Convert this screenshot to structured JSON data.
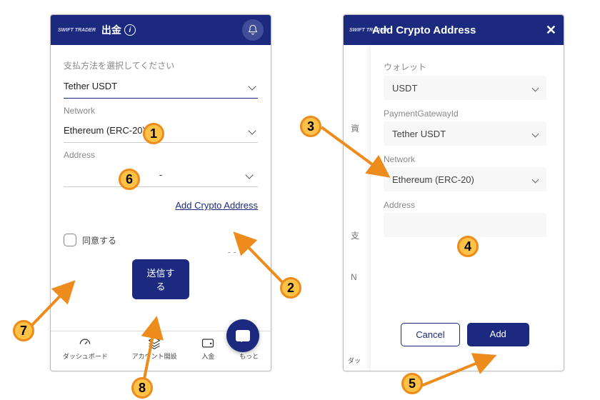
{
  "left": {
    "logo": "SWIFT TRADER",
    "title": "出金",
    "payment_label": "支払方法を選択してください",
    "payment_value": "Tether USDT",
    "network_label": "Network",
    "network_value": "Ethereum (ERC-20)",
    "address_label": "Address",
    "address_value": "-",
    "add_link": "Add Crypto Address",
    "agree": "同意する",
    "submit": "送信する",
    "dash": "- -",
    "nav": [
      {
        "label": "ダッシュボード"
      },
      {
        "label": "アカウント開設"
      },
      {
        "label": "入金"
      },
      {
        "label": "もっと"
      }
    ]
  },
  "right": {
    "logo": "SWIFT TRADER",
    "modal_title": "Add Crypto Address",
    "bg_labels": {
      "a": "資",
      "b": "支",
      "c": "N"
    },
    "bg_nav": "ダッ",
    "wallet_label": "ウォレット",
    "wallet_value": "USDT",
    "gateway_label": "PaymentGatewayId",
    "gateway_value": "Tether USDT",
    "network_label": "Network",
    "network_value": "Ethereum (ERC-20)",
    "address_label": "Address",
    "cancel": "Cancel",
    "add": "Add"
  },
  "callouts": {
    "c1": "1",
    "c2": "2",
    "c3": "3",
    "c4": "4",
    "c5": "5",
    "c6": "6",
    "c7": "7",
    "c8": "8"
  }
}
